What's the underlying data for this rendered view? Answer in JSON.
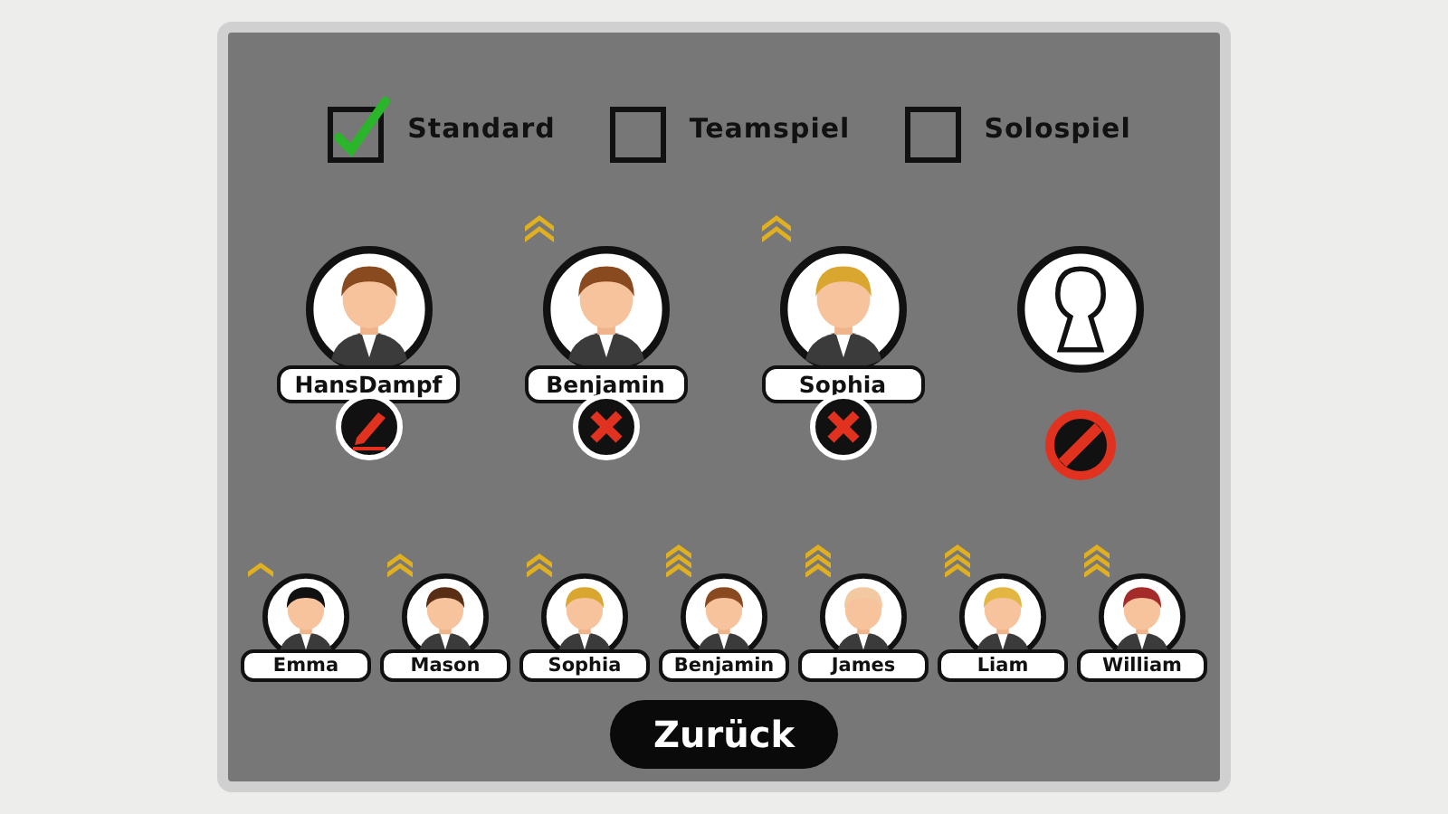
{
  "modes": [
    {
      "label": "Standard",
      "checked": true
    },
    {
      "label": "Teamspiel",
      "checked": false
    },
    {
      "label": "Solospiel",
      "checked": false
    }
  ],
  "team": [
    {
      "kind": "player",
      "name": "HansDampf",
      "rank": {
        "kind": "none"
      },
      "color": "#8a4a1f",
      "action": {
        "kind": "edit"
      }
    },
    {
      "kind": "player",
      "name": "Benjamin",
      "rank": {
        "kind": "two-chevrons"
      },
      "color": "#8a4a1f",
      "action": {
        "kind": "remove"
      }
    },
    {
      "kind": "player",
      "name": "Sophia",
      "rank": {
        "kind": "two-chevrons"
      },
      "color": "#d9a630",
      "action": {
        "kind": "remove"
      }
    },
    {
      "kind": "locked",
      "action": {
        "kind": "blocked"
      }
    }
  ],
  "bench": [
    {
      "name": "Emma",
      "rank": {
        "kind": "one-chevron"
      },
      "color": "#111111"
    },
    {
      "name": "Mason",
      "rank": {
        "kind": "two-chevrons"
      },
      "color": "#5a2e14"
    },
    {
      "name": "Sophia",
      "rank": {
        "kind": "two-chevrons"
      },
      "color": "#d9a630"
    },
    {
      "name": "Benjamin",
      "rank": {
        "kind": "three-chevrons"
      },
      "color": "#8a4a1f"
    },
    {
      "name": "James",
      "rank": {
        "kind": "three-chevrons"
      },
      "color": "#f2c9a0"
    },
    {
      "name": "Liam",
      "rank": {
        "kind": "three-chevrons"
      },
      "color": "#e2b640"
    },
    {
      "name": "William",
      "rank": {
        "kind": "three-chevrons"
      },
      "color": "#a52a2a"
    }
  ],
  "back_button": {
    "label": "Zurück"
  }
}
